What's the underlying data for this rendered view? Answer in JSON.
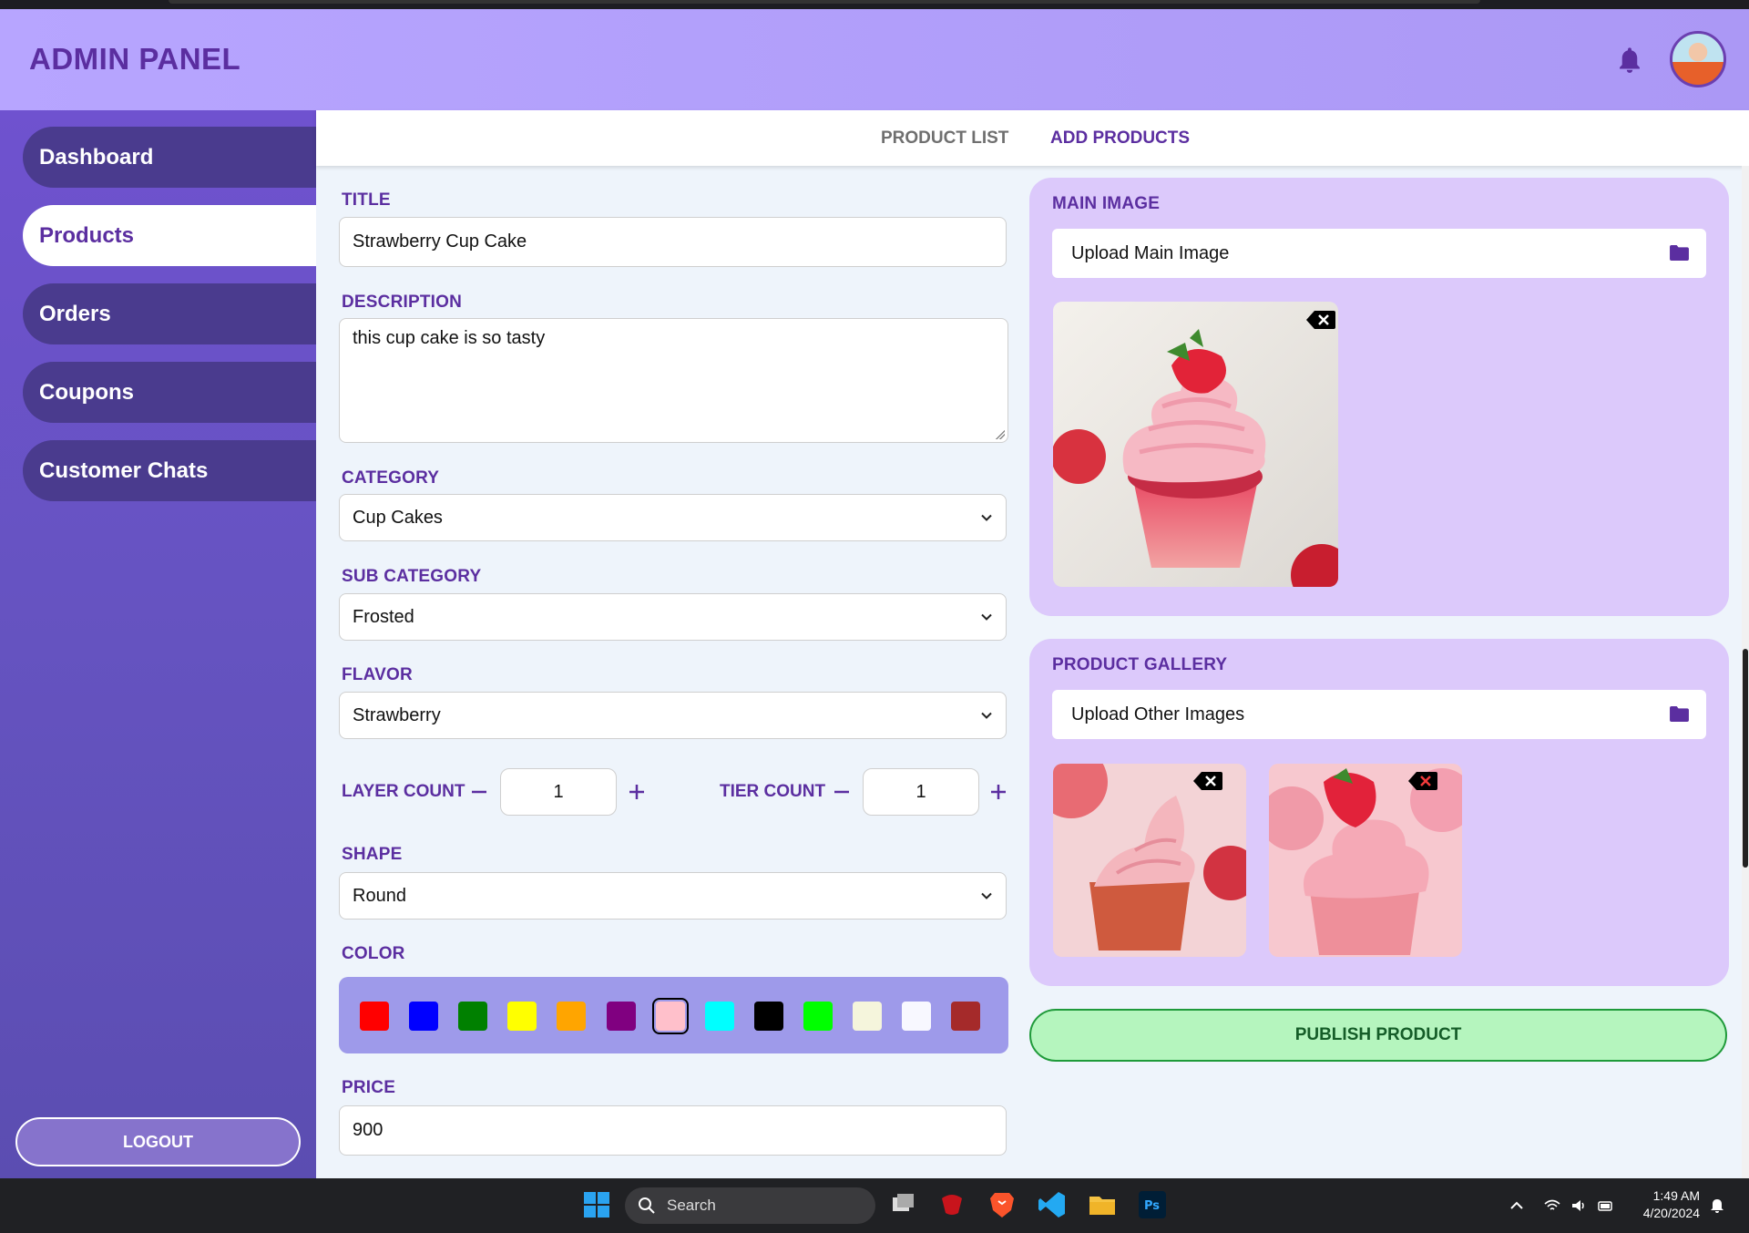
{
  "header": {
    "title": "ADMIN PANEL",
    "bell_icon": "bell-icon",
    "avatar_icon": "user-avatar"
  },
  "sidebar": {
    "items": [
      {
        "label": "Dashboard",
        "active": false
      },
      {
        "label": "Products",
        "active": true
      },
      {
        "label": "Orders",
        "active": false
      },
      {
        "label": "Coupons",
        "active": false
      },
      {
        "label": "Customer Chats",
        "active": false
      }
    ],
    "logout_label": "LOGOUT"
  },
  "tabs": [
    {
      "label": "PRODUCT LIST",
      "active": false
    },
    {
      "label": "ADD PRODUCTS",
      "active": true
    }
  ],
  "form": {
    "title_label": "TITLE",
    "title_value": "Strawberry Cup Cake",
    "description_label": "DESCRIPTION",
    "description_value": "this cup cake is so tasty",
    "category_label": "CATEGORY",
    "category_value": "Cup Cakes",
    "subcategory_label": "SUB CATEGORY",
    "subcategory_value": "Frosted",
    "flavor_label": "FLAVOR",
    "flavor_value": "Strawberry",
    "layer_count_label": "LAYER COUNT",
    "layer_count_value": "1",
    "tier_count_label": "TIER COUNT",
    "tier_count_value": "1",
    "shape_label": "SHAPE",
    "shape_value": "Round",
    "color_label": "COLOR",
    "colors": [
      "#ff0000",
      "#0000ff",
      "#008000",
      "#ffff00",
      "#ffa500",
      "#800080",
      "#ffc0cb",
      "#00ffff",
      "#000000",
      "#00ff00",
      "#f5f5dc",
      "#f8f8ff",
      "#a52a2a"
    ],
    "selected_color": "#ffc0cb",
    "price_label": "PRICE",
    "price_value": "900"
  },
  "main_image": {
    "label": "MAIN IMAGE",
    "upload_placeholder": "Upload Main Image",
    "folder_icon": "folder-icon",
    "remove_icon": "backspace-x-icon"
  },
  "gallery": {
    "label": "PRODUCT GALLERY",
    "upload_placeholder": "Upload Other Images",
    "folder_icon": "folder-icon",
    "image_count": 2
  },
  "publish_label": "PUBLISH PRODUCT",
  "taskbar": {
    "search_label": "Search",
    "time": "1:49 AM",
    "date": "4/20/2024"
  },
  "colors": {
    "brand_purple": "#5b2ea0",
    "header_bg": "#b7a5ff",
    "sidebar_bg": "#6553c0",
    "card_bg": "#dcc9fb",
    "publish_bg": "#b5f5be"
  }
}
